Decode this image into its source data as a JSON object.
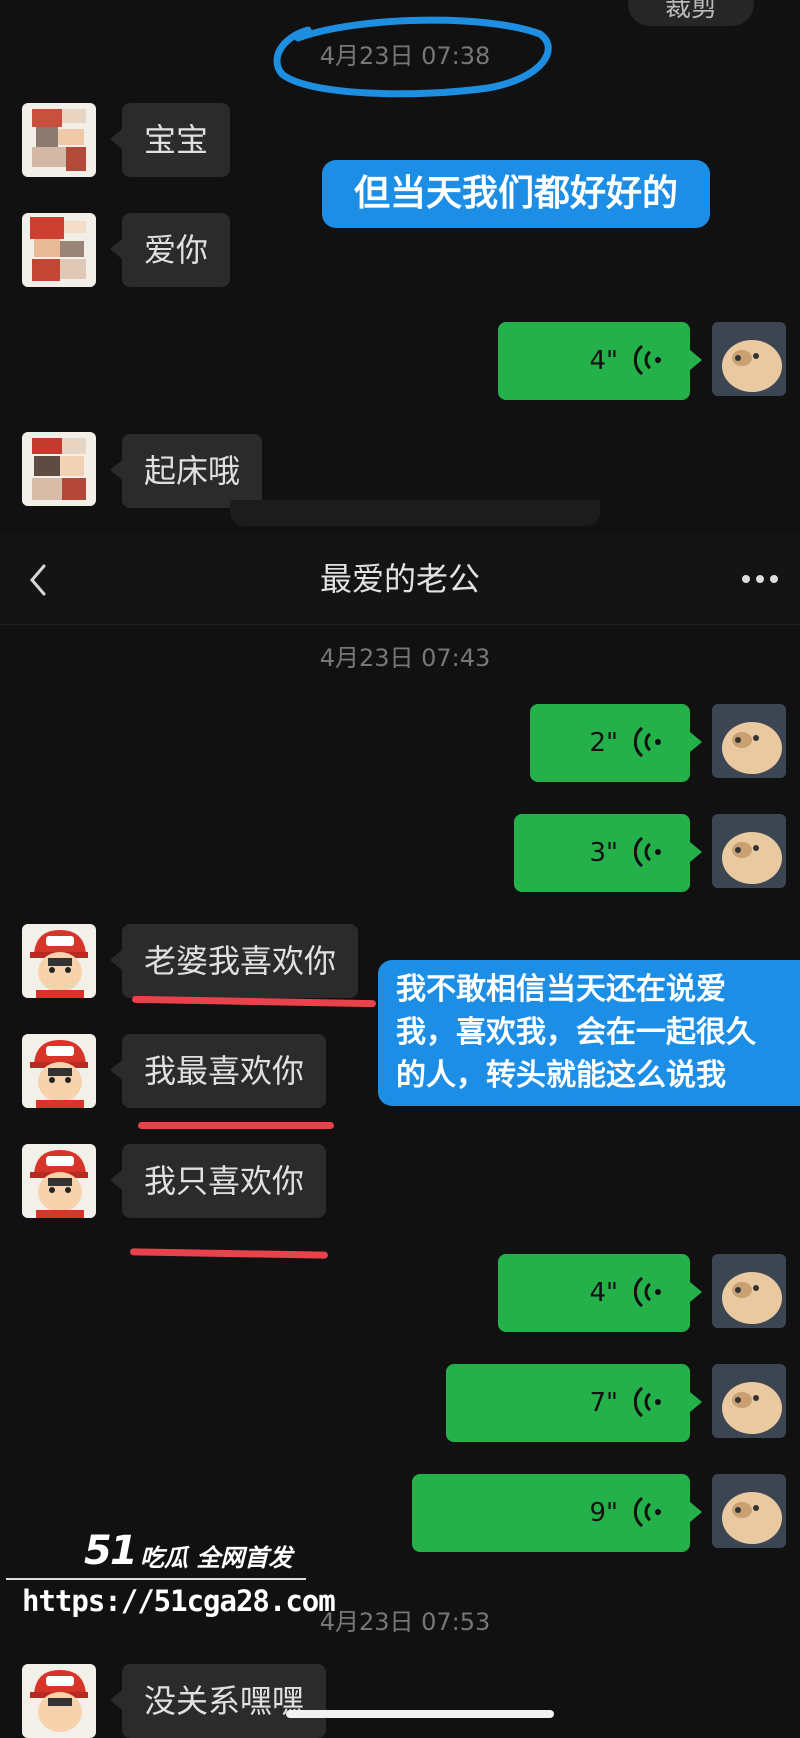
{
  "colors": {
    "background": "#111111",
    "incoming_bubble": "#2b2b2b",
    "outgoing_bubble": "#24b14a",
    "annotation": "#1d8ee6",
    "underline": "#e8424c",
    "timestamp": "#777777"
  },
  "top_button": {
    "label": "裁剪"
  },
  "screenshot1": {
    "timestamp": "4月23日 07:38",
    "messages": [
      {
        "dir": "in",
        "text": "宝宝"
      },
      {
        "dir": "in",
        "text": "爱你"
      },
      {
        "dir": "out",
        "voice": "4\""
      },
      {
        "dir": "in",
        "text": "起床哦"
      }
    ],
    "annotation": "但当天我们都好好的"
  },
  "header": {
    "back_icon": "chevron-left-icon",
    "title": "最爱的老公",
    "more_icon": "more-dots-icon"
  },
  "screenshot2": {
    "timestamp1": "4月23日 07:43",
    "messages": [
      {
        "dir": "out",
        "voice": "2\""
      },
      {
        "dir": "out",
        "voice": "3\""
      },
      {
        "dir": "in",
        "text": "老婆我喜欢你"
      },
      {
        "dir": "in",
        "text": "我最喜欢你"
      },
      {
        "dir": "in",
        "text": "我只喜欢你"
      },
      {
        "dir": "out",
        "voice": "4\""
      },
      {
        "dir": "out",
        "voice": "7\""
      },
      {
        "dir": "out",
        "voice": "9\""
      }
    ],
    "annotation_lines": [
      "我不敢相信当天还在说爱",
      "我，喜欢我，会在一起很久",
      "的人，转头就能这么说我"
    ],
    "timestamp2": "4月23日 07:53",
    "last_message": "没关系嘿嘿"
  },
  "watermark": {
    "brand": "51",
    "brand_text": "吃瓜 全网首发",
    "url": "https://51cga28.com"
  }
}
